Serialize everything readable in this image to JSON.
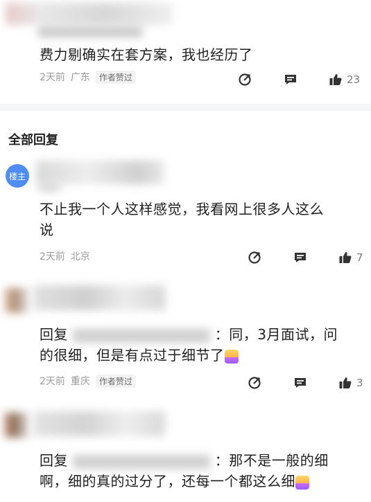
{
  "top_comment": {
    "blurred_line": "运维大计研发·4年",
    "text": "费力剔确实在套方案，我也经历了",
    "time": "2天前",
    "location": "广东",
    "badge": "作者赞过",
    "likes": "23"
  },
  "section": {
    "title": "全部回复"
  },
  "replies": [
    {
      "avatar_label": "楼主",
      "text_line1": "不止我一个人这样感觉，我看网上很多人这么",
      "text_line2": "说",
      "time": "2天前",
      "location": "北京",
      "badge": "",
      "likes": "7"
    },
    {
      "reply_prefix": "回复",
      "reply_suffix": "：同，3月面试，问",
      "text_line2": "的很细，但是有点过于细节了",
      "time": "2天前",
      "location": "重庆",
      "badge": "作者赞过",
      "likes": "3"
    },
    {
      "reply_prefix": "回复",
      "reply_suffix": "：那不是一般的细",
      "text_line2": "啊，细的真的过分了，还每一个都这么细"
    }
  ],
  "icons": {
    "share": "share-arrow-icon",
    "comment": "comment-icon",
    "like": "thumbs-up-icon"
  },
  "colors": {
    "louzhu_avatar": "#4f8df6",
    "divider": "#f4f5f7",
    "meta_text": "#9a9a9a"
  }
}
